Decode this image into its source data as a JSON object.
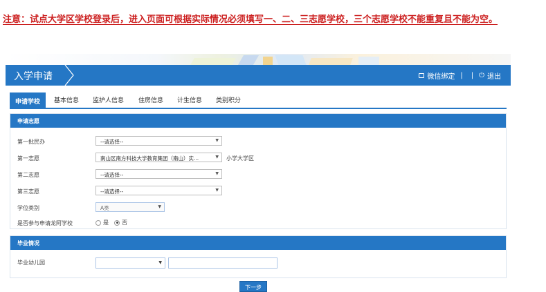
{
  "notice": "注意：试点大学区学校登录后，进入页面可根据实际情况必须填写一、二、三志愿学校，三个志愿学校不能重复且不能为空。",
  "header": {
    "title": "入学申请",
    "wechat_label": "微信绑定",
    "logout_label": "退出",
    "separator": "|"
  },
  "tabs": [
    {
      "label": "申请学校",
      "active": true
    },
    {
      "label": "基本信息"
    },
    {
      "label": "监护人信息"
    },
    {
      "label": "住房信息"
    },
    {
      "label": "计生信息"
    },
    {
      "label": "类别积分"
    }
  ],
  "apply_section": {
    "title": "申请志愿",
    "fields": [
      {
        "label": "第一批民办",
        "value": "--请选择--"
      },
      {
        "label": "第一志愿",
        "value": "南山区南方科技大学教育集团（南山）实...",
        "suffix": "小学大学区"
      },
      {
        "label": "第二志愿",
        "value": "--请选择--"
      },
      {
        "label": "第三志愿",
        "value": "--请选择--"
      },
      {
        "label": "学位类别",
        "value": "A类"
      }
    ],
    "dragon_school": {
      "label": "是否参与申请龙阿学校",
      "options": [
        "是",
        "否"
      ],
      "selected": "否"
    }
  },
  "grad_section": {
    "title": "毕业情况",
    "kindergarten_label": "毕业幼儿园",
    "kindergarten_select": "",
    "kindergarten_text": ""
  },
  "next_button": "下一步",
  "colors": {
    "primary": "#2577c5",
    "notice": "#cc1f1f"
  }
}
